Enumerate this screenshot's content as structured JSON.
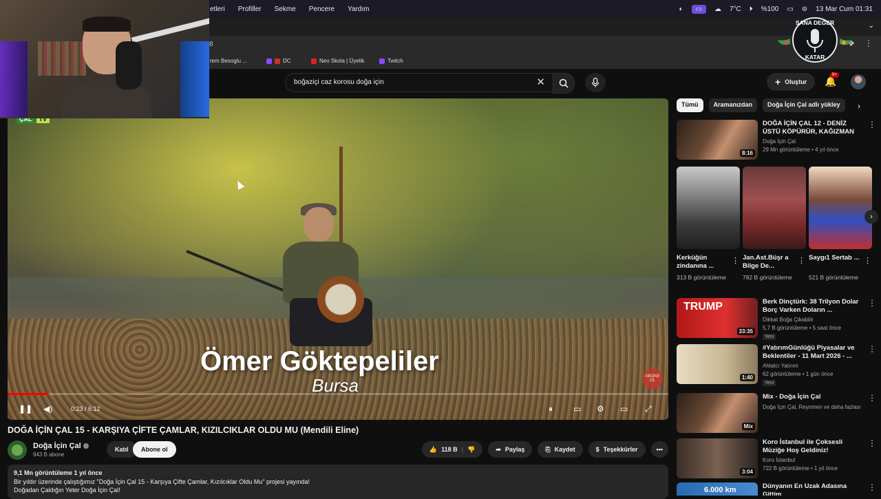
{
  "menubar": {
    "items": [
      "etleri",
      "Profiller",
      "Sekme",
      "Pencere",
      "Yardım"
    ],
    "weather": "7°C",
    "battery": "%100",
    "datetime": "13 Mar Cum  01:31"
  },
  "address": {
    "url_fragment": "8"
  },
  "bookmarks": [
    {
      "label": "rem Besoglu  ..."
    },
    {
      "label": "DC"
    },
    {
      "label": "Neo Skola | Üyelik"
    },
    {
      "label": "Twitch"
    }
  ],
  "header": {
    "search_query": "boğaziçi caz korosu doğa için",
    "create_label": "Oluştur",
    "notif_badge": "9+"
  },
  "player": {
    "overlay_logo_1": "ÇAL",
    "overlay_logo_2": "TV",
    "caption_name": "Ömer Göktepeliler",
    "caption_place": "Bursa",
    "abone_badge": "ABONE OL",
    "time": "0:23 / 6:12",
    "progress": 0.062
  },
  "video": {
    "title": "DOĞA İÇİN ÇAL 15 - KARŞIYA ÇİFTE ÇAMLAR, KIZILCIKLAR OLDU MU (Mendili Eline)",
    "channel": "Doğa İçin Çal",
    "subs": "943 B abone",
    "join": "Katıl",
    "subscribe": "Abone ol",
    "likes": "118 B",
    "share": "Paylaş",
    "save": "Kaydet",
    "thanks": "Teşekkürler",
    "desc_line1": "9,1 Mn görüntüleme  1 yıl önce",
    "desc_line2": "Bir yıldır üzerinde çalıştığımız \"Doğa İçin Çal 15 - Karşıya Çifte Çamlar, Kızılcıklar Oldu Mu\" projesi yayında!",
    "desc_line3": "Doğadan Çaldığın Yeter Doğa İçin Çal!"
  },
  "chips": [
    "Tümü",
    "Aramanızdan",
    "Doğa İçin Çal adlı yükley"
  ],
  "recs_top": {
    "title": "DOĞA İÇİN ÇAL 12 - DENİZ ÜSTÜ KÖPÜRÜR, KAĞIZMAN",
    "channel": "Doğa İçin Çal",
    "meta": "29 Mn görüntüleme • 4 yıl önce",
    "duration": "8:16"
  },
  "shorts": [
    {
      "title": "Kerküğün zindanına ...",
      "views": "313 B görüntüleme"
    },
    {
      "title": "Jan.Ast.Büşr a Bilge De...",
      "views": "782 B görüntüleme"
    },
    {
      "title": "Saygı1 Sertab ...",
      "views": "521 B görüntüleme"
    }
  ],
  "recs": [
    {
      "title": "Berk Dinçtürk: 38 Trilyon Dolar Borç Varken Doların ...",
      "channel": "Dikkat Boğa Çikabilir",
      "meta": "5,7 B görüntüleme • 5 saat önce",
      "new": "Yeni",
      "duration": "33:35",
      "thumb_text": "TRUMP"
    },
    {
      "title": "#YatırımGünlüğü Piyasalar ve Beklentiler - 11 Mart 2026 - ...",
      "channel": "Ahlatcı Yatırım",
      "meta": "62 görüntüleme • 1 gün önce",
      "new": "Yeni",
      "duration": "1:40",
      "thumb_text": ""
    },
    {
      "title": "Mix - Doğa İçin Çal",
      "channel": "Doğa İçin Çal, Reynmen ve daha fazlası",
      "meta": "",
      "new": "",
      "duration": "Mix",
      "thumb_text": ""
    },
    {
      "title": "Koro İstanbul ile  Çoksesli Müziğe Hoş Geldiniz!",
      "channel": "Koro İstanbul",
      "meta": "722 B görüntüleme • 1 yıl önce",
      "new": "",
      "duration": "3:04",
      "thumb_text": ""
    },
    {
      "title": "Dünyanın En Uzak Adasına Gittim",
      "channel": "",
      "meta": "",
      "new": "",
      "duration": "",
      "thumb_text": "6.000 km"
    }
  ],
  "logo": {
    "top": "SANA DEĞER",
    "bottom": "KATAR"
  }
}
